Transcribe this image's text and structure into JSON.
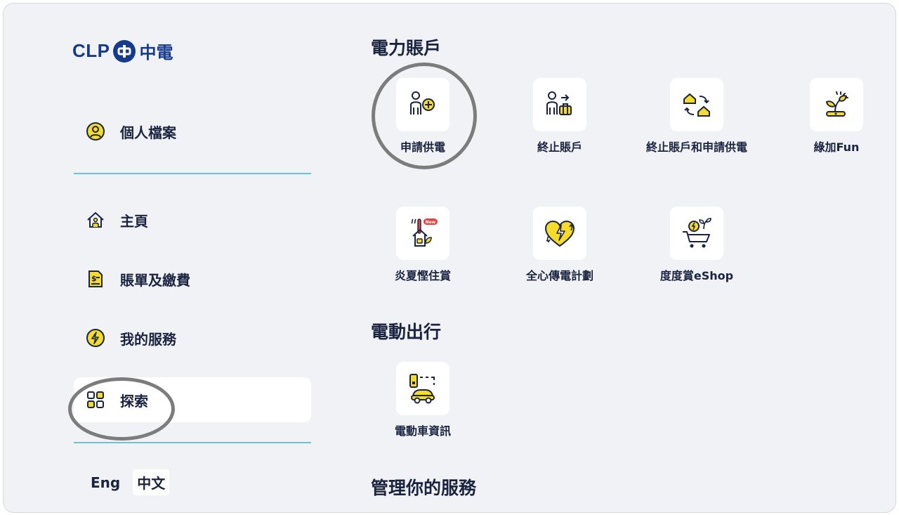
{
  "brand": {
    "logo_text": "CLP",
    "logo_zh": "中電"
  },
  "sidebar": {
    "profile_label": "個人檔案",
    "items": [
      {
        "label": "主頁",
        "icon": "home-icon"
      },
      {
        "label": "賬單及繳費",
        "icon": "bill-icon"
      },
      {
        "label": "我的服務",
        "icon": "lightning-icon"
      },
      {
        "label": "探索",
        "icon": "grid-icon",
        "active": true
      }
    ],
    "languages": [
      {
        "label": "Eng"
      },
      {
        "label": "中文",
        "selected": true
      }
    ]
  },
  "sections": [
    {
      "title": "電力賬戶",
      "tiles": [
        {
          "label": "申請供電",
          "icon": "person-plus-icon"
        },
        {
          "label": "終止賬戶",
          "icon": "person-luggage-icon"
        },
        {
          "label": "終止賬戶和申請供電",
          "icon": "house-swap-icon"
        },
        {
          "label": "綠加Fun",
          "icon": "plant-sprout-icon"
        },
        {
          "label": "炎夏慳住賞",
          "icon": "summer-saving-icon",
          "badge": "New"
        },
        {
          "label": "全心傳電計劃",
          "icon": "heart-power-icon"
        },
        {
          "label": "度度賞eShop",
          "icon": "eshop-cart-icon"
        }
      ]
    },
    {
      "title": "電動出行",
      "tiles": [
        {
          "label": "電動車資訊",
          "icon": "ev-car-icon"
        }
      ]
    },
    {
      "title": "管理你的服務",
      "tiles": []
    }
  ],
  "colors": {
    "brand_blue": "#163a8c",
    "accent_yellow": "#f5dc2a",
    "divider": "#6cc3d8",
    "background": "#f1f2f6"
  }
}
